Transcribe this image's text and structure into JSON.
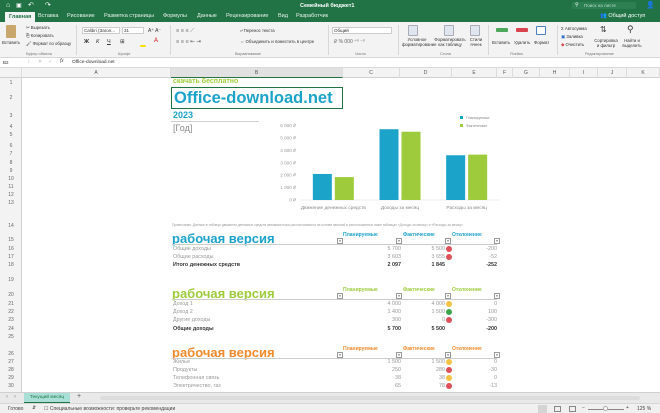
{
  "window": {
    "title": "Семейный бюджет1",
    "search_placeholder": "Поиск на листе",
    "share": "Общий доступ"
  },
  "tabs": [
    "Главная",
    "Вставка",
    "Рисование",
    "Разметка страницы",
    "Формулы",
    "Данные",
    "Рецензирование",
    "Вид",
    "Разработчик"
  ],
  "ribbon": {
    "paste": "Вставить",
    "cut": "Вырезать",
    "copy": "Копировать",
    "format_painter": "Формат по образцу",
    "font_name": "Calibri (Загол...",
    "font_size": "31",
    "wrap_text": "Перенос текста",
    "merge_center": "Объединить и поместить в центре",
    "number_format": "Общий",
    "cond_format": "Условное форматирование",
    "format_table": "Форматировать как таблицу",
    "cell_styles": "Стили ячеек",
    "insert": "Вставить",
    "delete": "Удалить",
    "format": "Формат",
    "autosum": "Автосумма",
    "fill": "Заливка",
    "clear": "Очистить",
    "sort_filter": "Сортировка и фильтр",
    "find_select": "Найти и выделить",
    "groups": [
      "Буфер обмена",
      "Шрифт",
      "Выравнивание",
      "Число",
      "Стили",
      "Ячейки",
      "Редактирование"
    ]
  },
  "formula_bar": {
    "name_box": "B2",
    "fx": "fx",
    "value": "Office-download.net"
  },
  "columns": [
    "A",
    "B",
    "C",
    "D",
    "E",
    "F",
    "G",
    "H",
    "I",
    "J",
    "K"
  ],
  "rows": [
    "1",
    "2",
    "3",
    "4",
    "5",
    "6",
    "7",
    "8",
    "9",
    "10",
    "11",
    "12",
    "13",
    "14",
    "15",
    "16",
    "17",
    "18",
    "19",
    "20",
    "21",
    "22",
    "23",
    "24",
    "25",
    "26",
    "27",
    "28",
    "29",
    "30"
  ],
  "sheet": {
    "tagline": "скачать бесплатно",
    "site": "Office-download.net",
    "year": "2023",
    "year_placeholder": "[Год]",
    "note": "Примечание. Данные в таблице движения денежных средств автоматически рассчитываются на основе записей в расположенных ниже таблицах «Доходы за месяц» и «Расходы за месяц»."
  },
  "colors": {
    "blue": "#1ba3c9",
    "green": "#9dcb3b",
    "orange": "#f08a2c",
    "excel_green": "#217346",
    "dot_red": "#e0505a",
    "dot_yellow": "#f4c244",
    "dot_green": "#3ea44c"
  },
  "chart_data": {
    "type": "bar",
    "categories": [
      "Движение денежных средств",
      "Доходы за месяц",
      "Расходы за месяц"
    ],
    "series": [
      {
        "name": "Планируемые",
        "values": [
          2097,
          5700,
          3603
        ],
        "color": "#1ba3c9"
      },
      {
        "name": "Фактические",
        "values": [
          1845,
          5500,
          3655
        ],
        "color": "#9dcb3b"
      }
    ],
    "yticks": [
      "0 ₽",
      "1 000 ₽",
      "2 000 ₽",
      "3 000 ₽",
      "4 000 ₽",
      "5 000 ₽",
      "6 000 ₽"
    ],
    "ylim": [
      0,
      6000
    ],
    "legend": "top-right",
    "grid": false
  },
  "tables": [
    {
      "title": "рабочая версия",
      "color": "#1ba3c9",
      "headers": [
        "Планируемые",
        "Фактические",
        "Отклонение"
      ],
      "rows": [
        {
          "label": "Общие доходы",
          "plan": "5 700",
          "fact": "5 500",
          "diff": "-200",
          "dot": "red"
        },
        {
          "label": "Общие расходы",
          "plan": "3 603",
          "fact": "3 655",
          "diff": "-52",
          "dot": "red"
        },
        {
          "label": "Итого денежных средств",
          "plan": "2 097",
          "fact": "1 845",
          "diff": "-252",
          "bold": true
        }
      ]
    },
    {
      "title": "рабочая версия",
      "color": "#9dcb3b",
      "headers": [
        "Планируемые",
        "Фактические",
        "Отклонение"
      ],
      "rows": [
        {
          "label": "Доход 1",
          "plan": "4 000",
          "fact": "4 000",
          "diff": "0",
          "dot": "yellow"
        },
        {
          "label": "Доход 2",
          "plan": "1 400",
          "fact": "1 500",
          "diff": "100",
          "dot": "green"
        },
        {
          "label": "Другие доходы",
          "plan": "300",
          "fact": "0",
          "diff": "-300",
          "dot": "red"
        },
        {
          "label": "Общие доходы",
          "plan": "5 700",
          "fact": "5 500",
          "diff": "-200",
          "bold": true
        }
      ]
    },
    {
      "title": "рабочая версия",
      "color": "#f08a2c",
      "headers": [
        "Планируемые",
        "Фактические",
        "Отклонение"
      ],
      "rows": [
        {
          "label": "Жилье",
          "plan": "1 500",
          "fact": "1 500",
          "diff": "0",
          "dot": "yellow"
        },
        {
          "label": "Продукты",
          "plan": "250",
          "fact": "280",
          "diff": "-30",
          "dot": "red"
        },
        {
          "label": "Телефонная связь",
          "plan": "38",
          "fact": "38",
          "diff": "0",
          "dot": "yellow"
        },
        {
          "label": "Электричество, газ",
          "plan": "65",
          "fact": "78",
          "diff": "-13",
          "dot": "red"
        }
      ]
    }
  ],
  "sheet_tabs": {
    "active": "Текущий месяц",
    "add": "+"
  },
  "status": {
    "ready": "Готово",
    "accessibility": "Специальные возможности: проверьте рекомендации",
    "zoom": "125 %"
  }
}
